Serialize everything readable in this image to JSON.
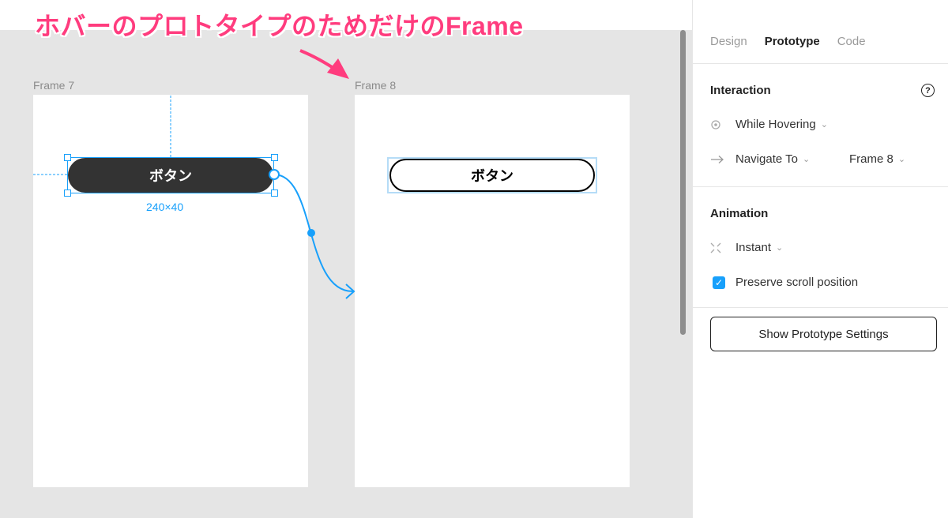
{
  "annotation": {
    "text": "ホバーのプロトタイプのためだけのFrame",
    "color": "#ff3c7e"
  },
  "canvas": {
    "frame7": {
      "label": "Frame 7",
      "button_label": "ボタン",
      "size_label": "240×40"
    },
    "frame8": {
      "label": "Frame 8",
      "button_label": "ボタン"
    },
    "selection_color": "#18a0fb"
  },
  "panel": {
    "tabs": [
      {
        "label": "Design",
        "active": false
      },
      {
        "label": "Prototype",
        "active": true
      },
      {
        "label": "Code",
        "active": false
      }
    ],
    "interaction": {
      "title": "Interaction",
      "help_icon": "?",
      "trigger": "While Hovering",
      "action": "Navigate To",
      "destination": "Frame 8"
    },
    "animation": {
      "title": "Animation",
      "type": "Instant",
      "preserve_scroll_label": "Preserve scroll position",
      "preserve_scroll_checked": true
    },
    "settings_button": "Show Prototype Settings"
  }
}
